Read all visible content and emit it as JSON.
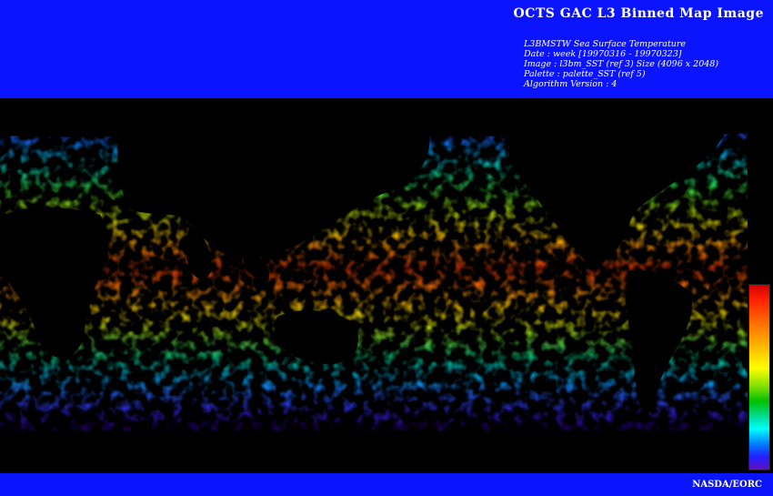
{
  "header": {
    "title": "OCTS GAC L3 Binned Map Image",
    "meta_lines": [
      "L3BMSTW Sea Surface Temperature",
      "Date : week [19970316 - 19970323]",
      "Image : l3bm_SST (ref 3) Size (4096 x 2048)",
      "Palette : palette_SST (ref 5)",
      "Algorithm Version : 4"
    ]
  },
  "footer": {
    "credit": "NASDA/EORC"
  },
  "colors": {
    "banner": "#0a14ff",
    "background": "#000000",
    "text": "#ffffff"
  },
  "colorbar": {
    "palette": [
      "#d40000",
      "#ff6a00",
      "#ffff00",
      "#00c000",
      "#00ffff",
      "#0080ff",
      "#6010c0"
    ],
    "orientation": "vertical"
  }
}
